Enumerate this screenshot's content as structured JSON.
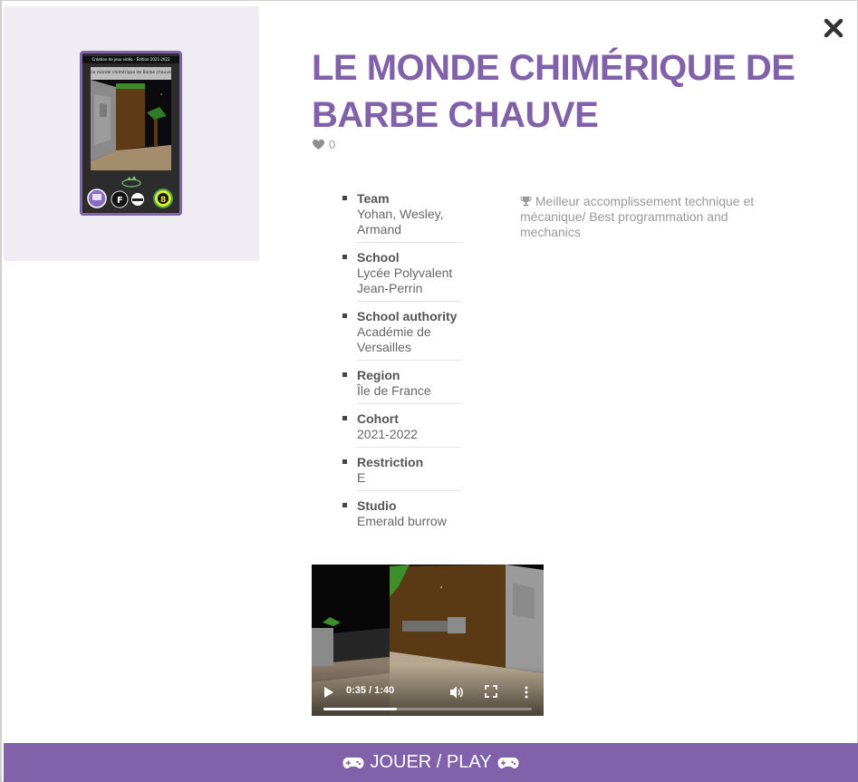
{
  "game": {
    "title": "LE MONDE CHIMÉRIQUE DE BARBE CHAUVE",
    "likes": "0",
    "award": "Meilleur accomplissement technique et mécanique/ Best programmation and mechanics"
  },
  "card": {
    "banner": "Création de jeux vidéo - Édition 2021-2022",
    "caption": "Le monde chimérique de Barbe chauve"
  },
  "details": [
    {
      "label": "Team",
      "value": "Yohan, Wesley, Armand"
    },
    {
      "label": "School",
      "value": "Lycée Polyvalent Jean-Perrin"
    },
    {
      "label": "School authority",
      "value": "Académie de Versailles"
    },
    {
      "label": "Region",
      "value": "Île de France"
    },
    {
      "label": "Cohort",
      "value": "2021-2022"
    },
    {
      "label": "Restriction",
      "value": "E"
    },
    {
      "label": "Studio",
      "value": "Emerald burrow"
    }
  ],
  "video": {
    "time": "0:35 / 1:40",
    "progress": 0.35
  },
  "play_button": {
    "label": "JOUER / PLAY"
  },
  "icons": {
    "close": "close-icon",
    "heart": "heart-icon",
    "trophy": "trophy-icon",
    "gamepad": "gamepad-icon"
  },
  "colors": {
    "accent": "#8162aa",
    "cover_bg": "#efecf4"
  }
}
